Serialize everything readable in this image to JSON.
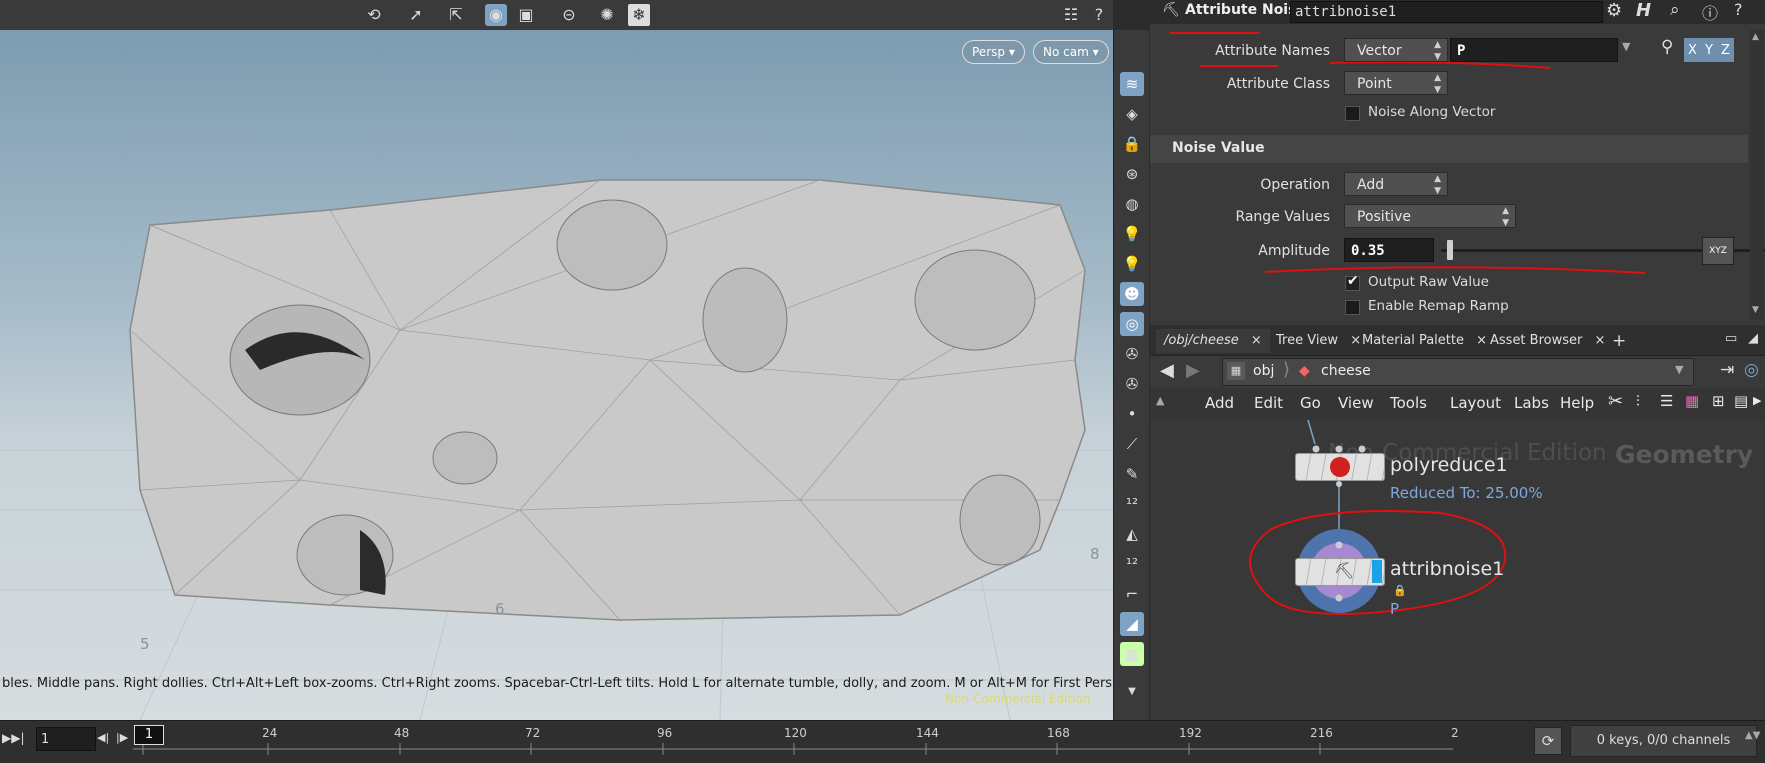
{
  "viewport": {
    "persp_label": "Persp",
    "cam_label": "No cam",
    "status_text": "bles. Middle pans. Right dollies. Ctrl+Alt+Left box-zooms. Ctrl+Right zooms. Spacebar-Ctrl-Left tilts. Hold L for alternate tumble, dolly, and zoom.     M or Alt+M for First Person",
    "watermark": "Non-Commercial Edition",
    "grid_labels": [
      "5",
      "6",
      "8"
    ]
  },
  "params": {
    "node_type": "Attribute Noise",
    "node_name": "attribnoise1",
    "attribute_names_label": "Attribute Names",
    "attribute_names_type": "Vector",
    "attribute_names_value": "P",
    "xyz": [
      "X",
      "Y",
      "Z"
    ],
    "attribute_class_label": "Attribute Class",
    "attribute_class_value": "Point",
    "noise_along_vector_label": "Noise Along Vector",
    "section_title": "Noise Value",
    "operation_label": "Operation",
    "operation_value": "Add",
    "range_values_label": "Range Values",
    "range_values_value": "Positive",
    "amplitude_label": "Amplitude",
    "amplitude_value": "0.35",
    "output_raw_label": "Output Raw Value",
    "enable_remap_label": "Enable Remap Ramp",
    "xyz_button": "XYZ"
  },
  "network": {
    "tabs": [
      "/obj/cheese",
      "Tree View",
      "Material Palette",
      "Asset Browser"
    ],
    "path": [
      "obj",
      "cheese"
    ],
    "menu": [
      "Add",
      "Edit",
      "Go",
      "View",
      "Tools",
      "Layout",
      "Labs",
      "Help"
    ],
    "watermark": "Non-Commercial Edition",
    "context_label": "Geometry",
    "nodes": [
      {
        "name": "polyreduce1",
        "info": "Reduced To: 25.00%"
      },
      {
        "name": "attribnoise1",
        "info": "P"
      }
    ]
  },
  "timeline": {
    "current_frame": "1",
    "frame_marker": "1",
    "ticks": [
      "24",
      "48",
      "72",
      "96",
      "120",
      "144",
      "168",
      "192",
      "216",
      "2"
    ],
    "keys_status": "0 keys, 0/0 channels"
  }
}
